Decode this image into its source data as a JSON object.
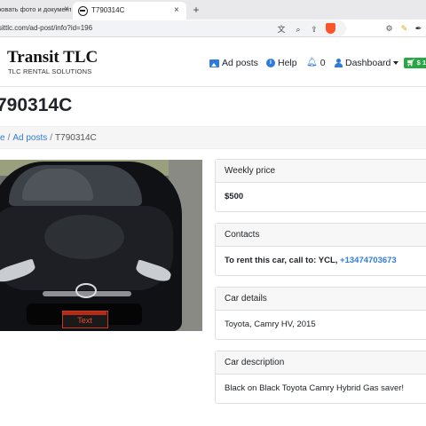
{
  "browser": {
    "inactive_tab_title": "ровать фото и документ",
    "active_tab_title": "T790314C",
    "url": "sittlc.com/ad-post/info?id=196"
  },
  "site": {
    "brand": "Transit TLC",
    "tagline": "TLC RENTAL SOLUTIONS",
    "nav": {
      "ad_posts": "Ad posts",
      "help": "Help",
      "notifications_count": "0",
      "dashboard": "Dashboard",
      "cart": "$ 1"
    }
  },
  "page": {
    "title": "790314C",
    "breadcrumb": {
      "home": "e",
      "ad_posts": "Ad posts",
      "current": "T790314C"
    },
    "photo": {
      "plate_text": "Text"
    }
  },
  "cards": {
    "weekly_price": {
      "header": "Weekly price",
      "value": "$500"
    },
    "contacts": {
      "header": "Contacts",
      "lead": "To rent this car, call to: YCL,",
      "phone": "+13474703673"
    },
    "car_details": {
      "header": "Car details",
      "value": "Toyota, Camry HV, 2015"
    },
    "car_description": {
      "header": "Car description",
      "value": "Black on Black Toyota Camry Hybrid Gas saver!"
    }
  },
  "colors": {
    "link": "#2f7bd8",
    "cart_badge": "#28a745"
  }
}
